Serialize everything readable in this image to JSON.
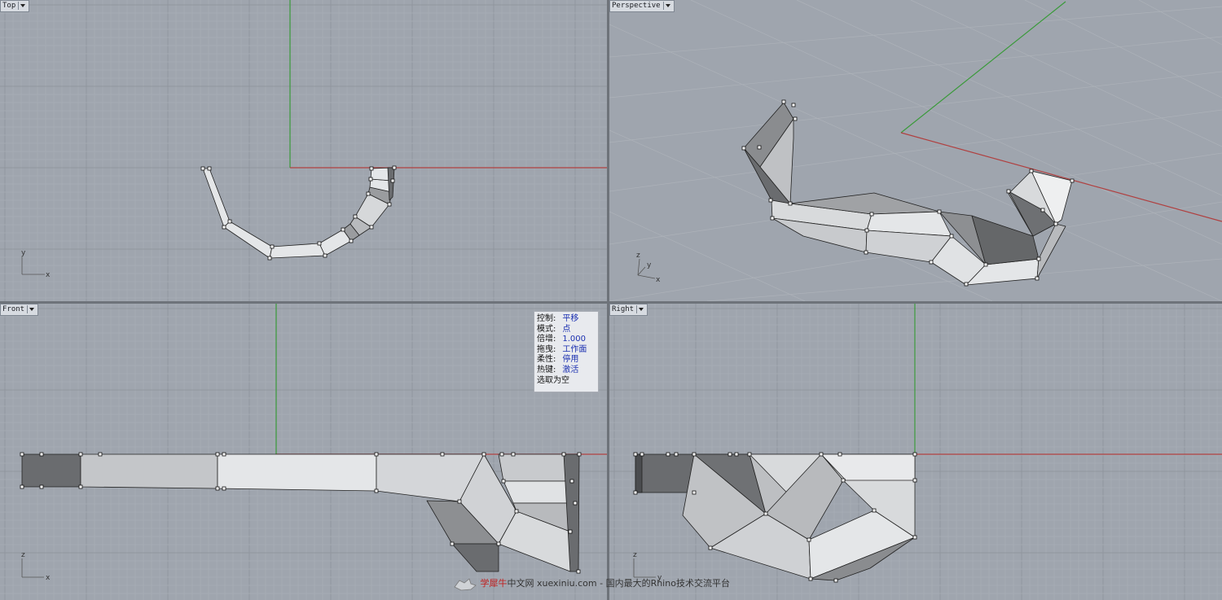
{
  "viewports": {
    "top": {
      "label": "Top"
    },
    "perspective": {
      "label": "Perspective"
    },
    "front": {
      "label": "Front"
    },
    "right": {
      "label": "Right"
    }
  },
  "axis_labels": {
    "x": "x",
    "y": "y",
    "z": "z"
  },
  "gumball_panel": {
    "rows": [
      {
        "key": "控制:",
        "value": "平移"
      },
      {
        "key": "模式:",
        "value": "点"
      },
      {
        "key": "倍增:",
        "value": "1.000"
      },
      {
        "key": "拖曳:",
        "value": "工作面"
      },
      {
        "key": "柔性:",
        "value": "停用"
      },
      {
        "key": "热键:",
        "value": "激活"
      }
    ],
    "footer": "选取为空"
  },
  "watermark": {
    "brand": "学犀牛",
    "site": "中文网 xuexiniu.com - 国内最大的Rhino技术交流平台",
    "icon": "rhino-logo-icon"
  },
  "colors": {
    "viewport_bg": "#9fa5ae",
    "grid_minor": "#a8aeb6",
    "grid_major": "#8c929a",
    "x_axis": "#b04040",
    "y_axis": "#3a9a3a",
    "face_light": "#e4e6e8",
    "face_mid": "#b8babd",
    "face_dark": "#6a6c6f"
  }
}
